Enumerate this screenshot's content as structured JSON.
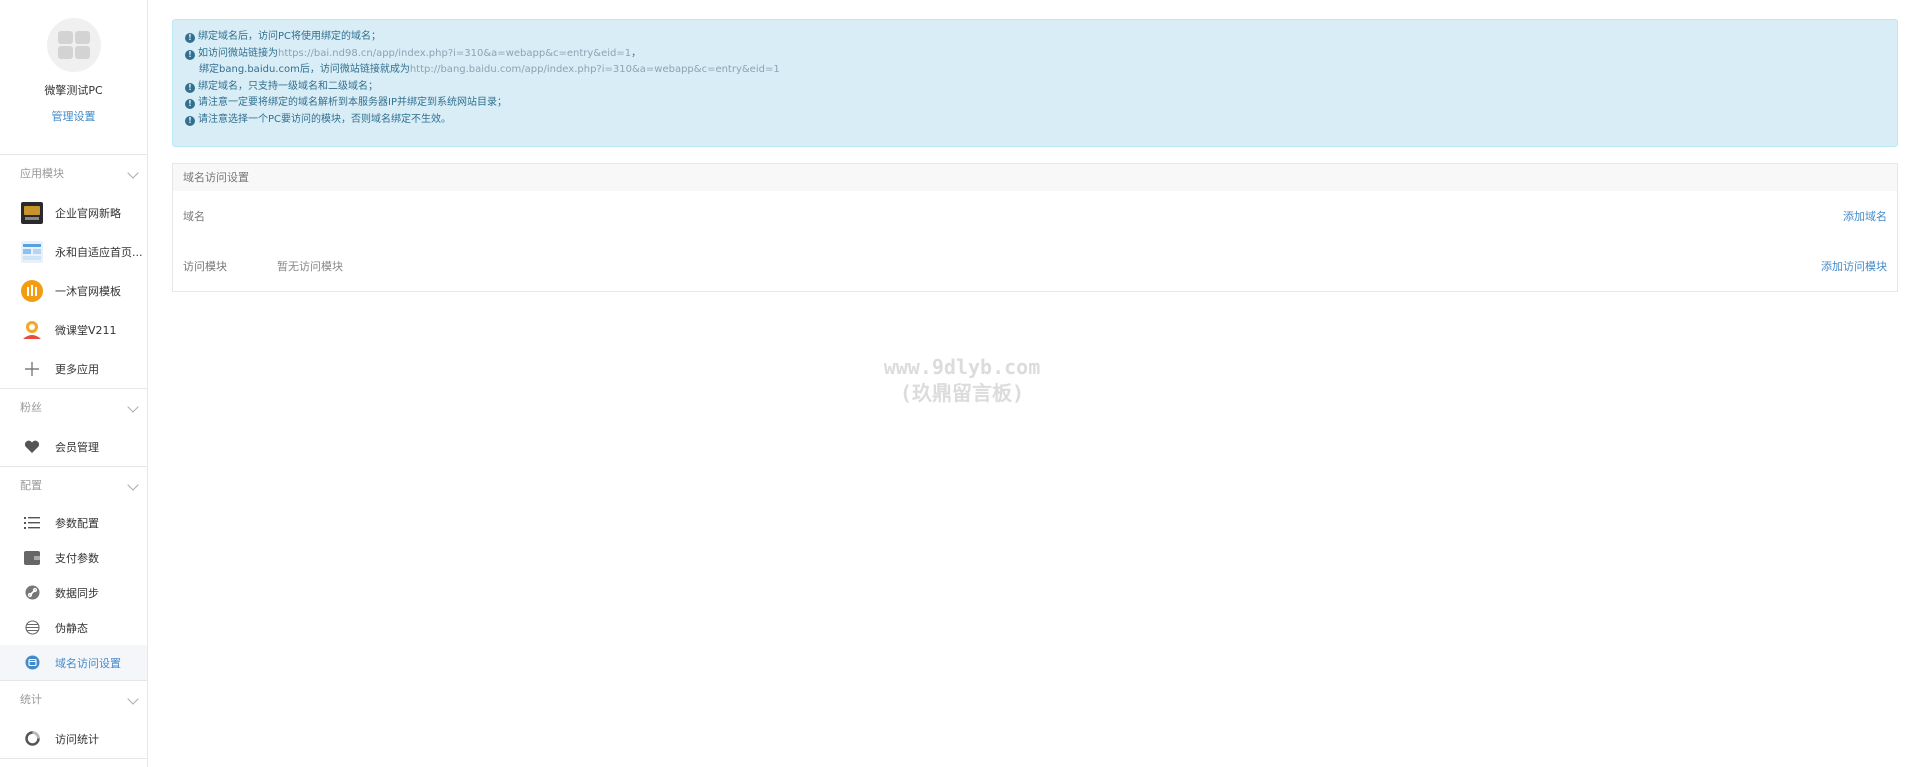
{
  "sidebar": {
    "account_name": "微擎测试PC",
    "manage_link": "管理设置",
    "groups": [
      {
        "title": "应用模块",
        "items": [
          {
            "label": "企业官网新略",
            "icon": "module-thumbnail-icon"
          },
          {
            "label": "永和自适应首页...",
            "icon": "module-thumbnail-icon"
          },
          {
            "label": "一沐官网模板",
            "icon": "module-thumbnail-icon"
          },
          {
            "label": "微课堂V211",
            "icon": "module-thumbnail-icon"
          },
          {
            "label": "更多应用",
            "icon": "plus-icon"
          }
        ]
      },
      {
        "title": "粉丝",
        "items": [
          {
            "label": "会员管理",
            "icon": "heart-icon"
          }
        ]
      },
      {
        "title": "配置",
        "items": [
          {
            "label": "参数配置",
            "icon": "list-icon"
          },
          {
            "label": "支付参数",
            "icon": "wallet-icon"
          },
          {
            "label": "数据同步",
            "icon": "link-icon"
          },
          {
            "label": "伪静态",
            "icon": "globe-icon"
          },
          {
            "label": "域名访问设置",
            "icon": "domain-icon",
            "active": true
          }
        ]
      },
      {
        "title": "统计",
        "items": [
          {
            "label": "访问统计",
            "icon": "pie-icon"
          }
        ]
      }
    ]
  },
  "alert": {
    "line1": "绑定域名后，访问PC将使用绑定的域名；",
    "line2_prefix": "如访问微站链接为",
    "line2_url": "https://bai.nd98.cn/app/index.php?i=310&a=webapp&c=entry&eid=1",
    "line2_suffix": "，",
    "line3_prefix": "绑定bang.baidu.com后，访问微站链接就成为",
    "line3_url": "http://bang.baidu.com/app/index.php?i=310&a=webapp&c=entry&eid=1",
    "line4": "绑定域名，只支持一级域名和二级域名；",
    "line5": "请注意一定要将绑定的域名解析到本服务器IP并绑定到系统网站目录；",
    "line6": "请注意选择一个PC要访问的模块，否则域名绑定不生效。"
  },
  "panel": {
    "heading": "域名访问设置",
    "domain_label": "域名",
    "domain_action": "添加域名",
    "module_label": "访问模块",
    "module_value": "暂无访问模块",
    "module_action": "添加访问模块"
  },
  "watermark": {
    "line1": "www.9dlyb.com",
    "line2": "(玖鼎留言板)"
  },
  "colors": {
    "link": "#428bca",
    "alert_bg": "#d9edf7",
    "alert_text": "#31708f"
  }
}
